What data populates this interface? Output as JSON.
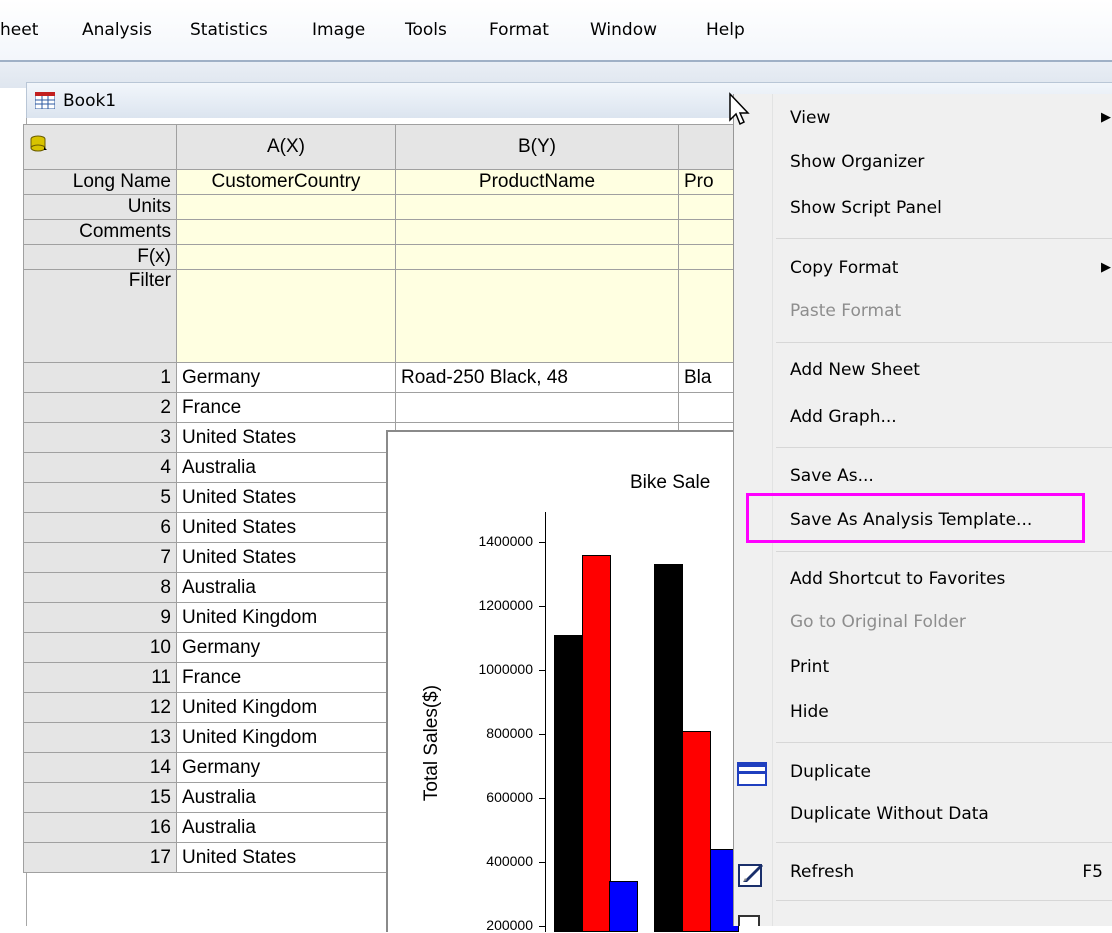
{
  "menubar": {
    "items": [
      "heet",
      "Analysis",
      "Statistics",
      "Image",
      "Tools",
      "Format",
      "Window",
      "Help"
    ]
  },
  "book": {
    "title": "Book1",
    "columns": [
      "A(X)",
      "B(Y)"
    ],
    "meta_rows": [
      "Long Name",
      "Units",
      "Comments",
      "F(x)",
      "Filter"
    ],
    "long_names": [
      "CustomerCountry",
      "ProductName",
      "Pro"
    ],
    "rows": [
      {
        "n": "1",
        "a": "Germany",
        "b": "Road-250 Black, 48",
        "c": "Bla"
      },
      {
        "n": "2",
        "a": "France"
      },
      {
        "n": "3",
        "a": "United States"
      },
      {
        "n": "4",
        "a": "Australia"
      },
      {
        "n": "5",
        "a": "United States"
      },
      {
        "n": "6",
        "a": "United States"
      },
      {
        "n": "7",
        "a": "United States"
      },
      {
        "n": "8",
        "a": "Australia"
      },
      {
        "n": "9",
        "a": "United Kingdom"
      },
      {
        "n": "10",
        "a": "Germany"
      },
      {
        "n": "11",
        "a": "France"
      },
      {
        "n": "12",
        "a": "United Kingdom"
      },
      {
        "n": "13",
        "a": "United Kingdom"
      },
      {
        "n": "14",
        "a": "Germany"
      },
      {
        "n": "15",
        "a": "Australia"
      },
      {
        "n": "16",
        "a": "Australia"
      },
      {
        "n": "17",
        "a": "United States"
      }
    ]
  },
  "graph": {
    "title": "Bike Sale",
    "ylabel": "Total Sales($)",
    "yticks": [
      "1400000",
      "1200000",
      "1000000",
      "800000",
      "600000",
      "400000",
      "200000"
    ],
    "bars": [
      {
        "value": 1110000,
        "color": "#000000"
      },
      {
        "value": 1360000,
        "color": "#ff0000"
      },
      {
        "value": 340000,
        "color": "#0000ff"
      },
      {
        "value": 1330000,
        "color": "#000000"
      },
      {
        "value": 810000,
        "color": "#ff0000"
      },
      {
        "value": 440000,
        "color": "#0000ff"
      }
    ]
  },
  "context_menu": {
    "view": "View",
    "show_organizer": "Show Organizer",
    "show_script_panel": "Show Script Panel",
    "copy_format": "Copy Format",
    "paste_format": "Paste Format",
    "add_new_sheet": "Add New Sheet",
    "add_graph": "Add Graph...",
    "save_as": "Save As...",
    "save_as_analysis_template": "Save As Analysis Template...",
    "add_shortcut": "Add Shortcut to Favorites",
    "go_to_original": "Go to Original Folder",
    "print": "Print",
    "hide": "Hide",
    "duplicate": "Duplicate",
    "duplicate_without_data": "Duplicate Without Data",
    "refresh": "Refresh",
    "refresh_shortcut": "F5"
  },
  "colors": {
    "highlight": "#ff00ff",
    "header_yellow": "#ffffe1"
  }
}
